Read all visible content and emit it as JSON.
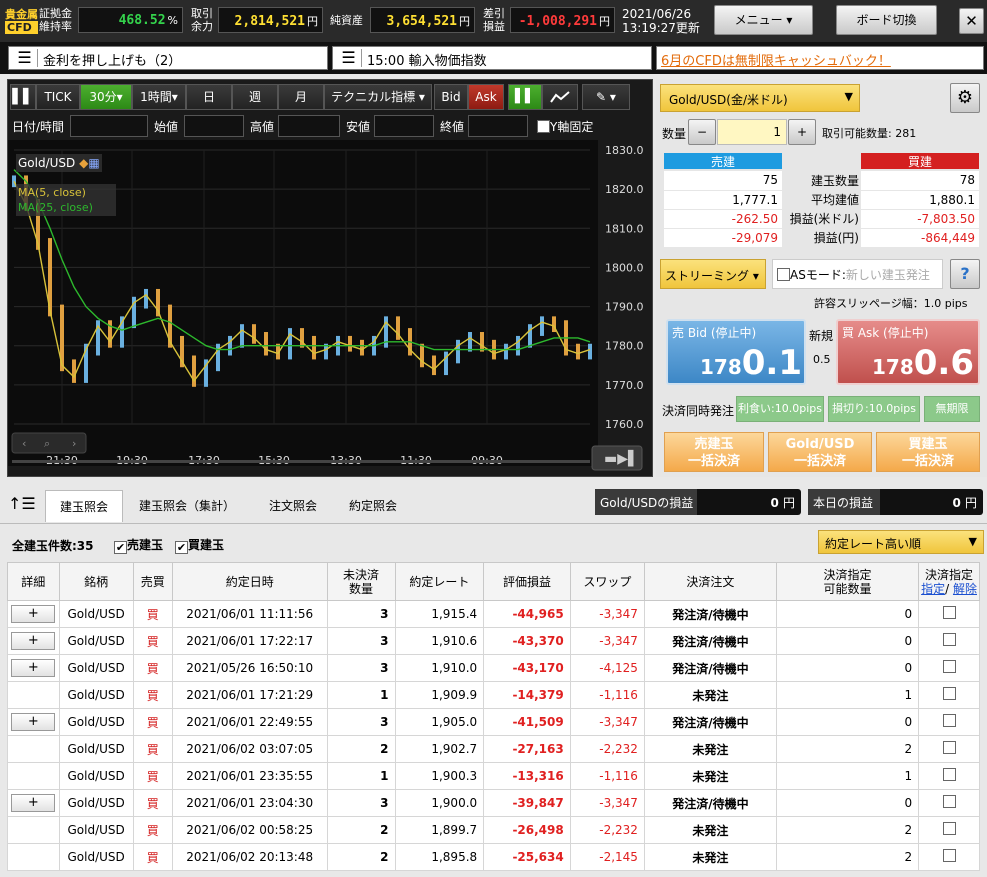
{
  "top": {
    "logo_line1": "貴金属",
    "logo_line2": "CFD",
    "margin_label": "証拠金\n維持率",
    "margin_value": "468.52",
    "margin_unit": "%",
    "avail_label": "取引\n余力",
    "avail_value": "2,814,521",
    "avail_unit": "円",
    "net_label": "純資産",
    "net_value": "3,654,521",
    "net_unit": "円",
    "pl_label": "差引\n損益",
    "pl_value": "-1,008,291",
    "pl_unit": "円",
    "date": "2021/06/26",
    "time": "13:19:27更新",
    "menu_label": "メニュー",
    "board_label": "ボード切換",
    "close_label": "✕"
  },
  "news": {
    "item1": "金利を押し上げも（2）",
    "item2": "15:00 輸入物価指数",
    "promo": "6月のCFDは無制限キャッシュバック！"
  },
  "chart_toolbar": {
    "tick": "TICK",
    "min30": "30分",
    "hour1": "1時間",
    "day": "日",
    "week": "週",
    "month": "月",
    "technical": "テクニカル指標",
    "bid": "Bid",
    "ask": "Ask"
  },
  "ohlc": {
    "datetime": "日付/時間",
    "open": "始値",
    "high": "高値",
    "low": "安値",
    "close": "終値",
    "yfix": "Y軸固定"
  },
  "chart_labels": {
    "symbol": "Gold/USD",
    "ma5": "MA(5, close)",
    "ma25": "MA(25, close)"
  },
  "chart_data": {
    "type": "line",
    "y_ticks": [
      "1830.0",
      "1820.0",
      "1810.0",
      "1800.0",
      "1790.0",
      "1780.0",
      "1770.0",
      "1760.0"
    ],
    "x_ticks": [
      "21:30",
      "19:30",
      "17:30",
      "15:30",
      "13:30",
      "11:30",
      "09:30"
    ],
    "ylim": [
      1760,
      1830
    ],
    "series": [
      {
        "name": "MA(5, close)",
        "color": "#d8c23a",
        "values": [
          1822,
          1816,
          1806,
          1789,
          1775,
          1772,
          1779,
          1785,
          1781,
          1786,
          1791,
          1793,
          1789,
          1781,
          1776,
          1771,
          1775,
          1779,
          1781,
          1784,
          1782,
          1779,
          1778,
          1783,
          1781,
          1778,
          1779,
          1781,
          1780,
          1779,
          1781,
          1786,
          1783,
          1779,
          1776,
          1774,
          1777,
          1780,
          1782,
          1780,
          1778,
          1779,
          1781,
          1784,
          1786,
          1785,
          1779,
          1778,
          1779
        ]
      },
      {
        "name": "MA(25, close)",
        "color": "#2db82d",
        "values": [
          1825,
          1822,
          1817,
          1810,
          1802,
          1795,
          1790,
          1787,
          1785,
          1784,
          1785,
          1786,
          1787,
          1786,
          1784,
          1782,
          1780,
          1779,
          1779,
          1780,
          1780,
          1780,
          1780,
          1780,
          1780,
          1780,
          1780,
          1780,
          1780,
          1780,
          1780,
          1781,
          1781,
          1781,
          1780,
          1779,
          1779,
          1779,
          1779,
          1779,
          1779,
          1779,
          1779,
          1780,
          1781,
          1782,
          1782,
          1782,
          1781
        ]
      }
    ]
  },
  "panel": {
    "symbol": "Gold/USD(金/米ドル)",
    "qty_label": "数量",
    "qty_value": "1",
    "minus": "−",
    "plus": "+",
    "tradable": "取引可能数量: 281",
    "sell_header": "売建",
    "buy_header": "買建",
    "rows": [
      {
        "sell": "75",
        "label": "建玉数量",
        "buy": "78",
        "neg": false
      },
      {
        "sell": "1,777.1",
        "label": "平均建値",
        "buy": "1,880.1",
        "neg": false
      },
      {
        "sell": "-262.50",
        "label": "損益(米ドル)",
        "buy": "-7,803.50",
        "neg": true
      },
      {
        "sell": "-29,079",
        "label": "損益(円)",
        "buy": "-864,449",
        "neg": true
      }
    ],
    "streaming": "ストリーミング",
    "as_mode": "ASモード:",
    "as_placeholder": "新しい建玉発注",
    "help": "?",
    "slippage": "許容スリッページ幅：1.0 pips",
    "bid_title": "売 Bid (停止中)",
    "bid_small": "178",
    "bid_big": "0.1",
    "ask_title": "買 Ask (停止中)",
    "ask_small": "178",
    "ask_big": "0.6",
    "new_label": "新規",
    "spread": "0.5",
    "settle_label": "決済同時発注",
    "profit": "利食い:10.0pips",
    "loss": "損切り:10.0pips",
    "unlimited": "無期限",
    "bulk_sell_1": "売建玉",
    "bulk_sell_2": "一括決済",
    "bulk_sym_1": "Gold/USD",
    "bulk_sym_2": "一括決済",
    "bulk_buy_1": "買建玉",
    "bulk_buy_2": "一括決済"
  },
  "tabs": {
    "t1": "建玉照会",
    "t2": "建玉照会（集計）",
    "t3": "注文照会",
    "t4": "約定照会",
    "pl_sym_label": "Gold/USDの損益",
    "pl_sym_value": "0",
    "pl_today_label": "本日の損益",
    "pl_today_value": "0",
    "yen": "円"
  },
  "filter": {
    "total": "全建玉件数:35",
    "sell": "売建玉",
    "buy": "買建玉",
    "sort": "約定レート高い順"
  },
  "table": {
    "headers": [
      "詳細",
      "銘柄",
      "売買",
      "約定日時",
      "未決済\n数量",
      "約定レート",
      "評価損益",
      "スワップ",
      "決済注文",
      "決済指定\n可能数量",
      "決済指定"
    ],
    "spec_link": "指定",
    "release_link": "解除",
    "rows": [
      {
        "detail": "+",
        "sym": "Gold/USD",
        "side": "買",
        "dt": "2021/06/01 11:11:56",
        "qty": "3",
        "rate": "1,915.4",
        "pl": "-44,965",
        "swap": "-3,347",
        "order": "発注済/待機中",
        "avail": "0"
      },
      {
        "detail": "+",
        "sym": "Gold/USD",
        "side": "買",
        "dt": "2021/06/01 17:22:17",
        "qty": "3",
        "rate": "1,910.6",
        "pl": "-43,370",
        "swap": "-3,347",
        "order": "発注済/待機中",
        "avail": "0"
      },
      {
        "detail": "+",
        "sym": "Gold/USD",
        "side": "買",
        "dt": "2021/05/26 16:50:10",
        "qty": "3",
        "rate": "1,910.0",
        "pl": "-43,170",
        "swap": "-4,125",
        "order": "発注済/待機中",
        "avail": "0"
      },
      {
        "detail": "",
        "sym": "Gold/USD",
        "side": "買",
        "dt": "2021/06/01 17:21:29",
        "qty": "1",
        "rate": "1,909.9",
        "pl": "-14,379",
        "swap": "-1,116",
        "order": "未発注",
        "avail": "1"
      },
      {
        "detail": "+",
        "sym": "Gold/USD",
        "side": "買",
        "dt": "2021/06/01 22:49:55",
        "qty": "3",
        "rate": "1,905.0",
        "pl": "-41,509",
        "swap": "-3,347",
        "order": "発注済/待機中",
        "avail": "0"
      },
      {
        "detail": "",
        "sym": "Gold/USD",
        "side": "買",
        "dt": "2021/06/02 03:07:05",
        "qty": "2",
        "rate": "1,902.7",
        "pl": "-27,163",
        "swap": "-2,232",
        "order": "未発注",
        "avail": "2"
      },
      {
        "detail": "",
        "sym": "Gold/USD",
        "side": "買",
        "dt": "2021/06/01 23:35:55",
        "qty": "1",
        "rate": "1,900.3",
        "pl": "-13,316",
        "swap": "-1,116",
        "order": "未発注",
        "avail": "1"
      },
      {
        "detail": "+",
        "sym": "Gold/USD",
        "side": "買",
        "dt": "2021/06/01 23:04:30",
        "qty": "3",
        "rate": "1,900.0",
        "pl": "-39,847",
        "swap": "-3,347",
        "order": "発注済/待機中",
        "avail": "0"
      },
      {
        "detail": "",
        "sym": "Gold/USD",
        "side": "買",
        "dt": "2021/06/02 00:58:25",
        "qty": "2",
        "rate": "1,899.7",
        "pl": "-26,498",
        "swap": "-2,232",
        "order": "未発注",
        "avail": "2"
      },
      {
        "detail": "",
        "sym": "Gold/USD",
        "side": "買",
        "dt": "2021/06/02 20:13:48",
        "qty": "2",
        "rate": "1,895.8",
        "pl": "-25,634",
        "swap": "-2,145",
        "order": "未発注",
        "avail": "2"
      }
    ]
  }
}
